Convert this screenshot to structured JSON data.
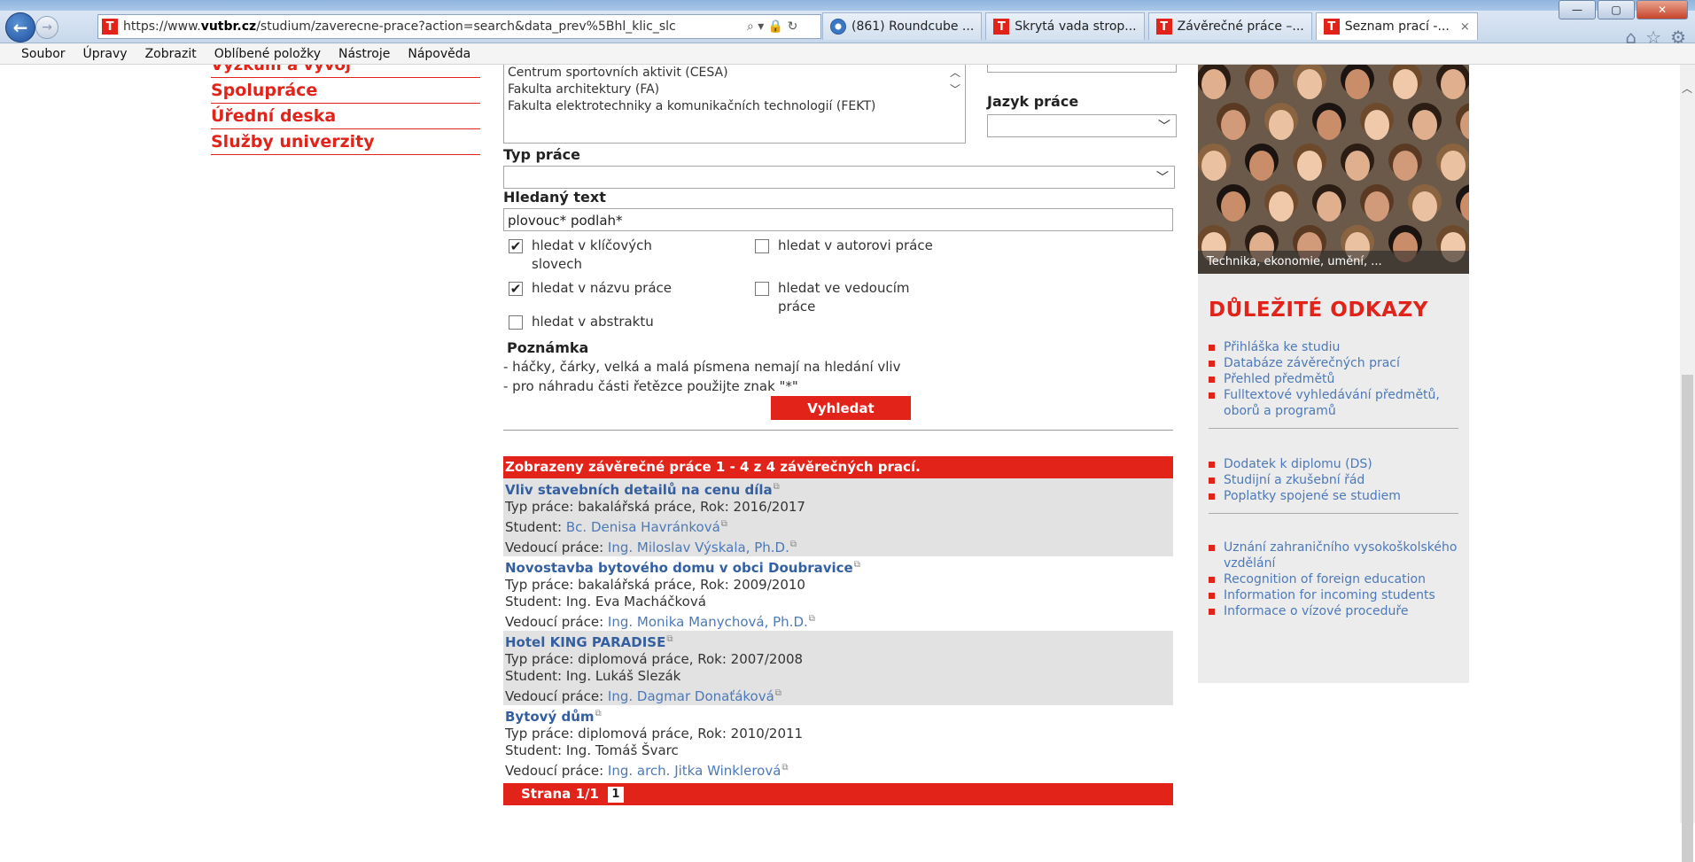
{
  "browser": {
    "address": {
      "scheme": "https://www.",
      "domain": "vutbr.cz",
      "path": "/studium/zaverecne-prace?action=search&data_prev%5Bhl_klic_slc",
      "icons": "⌕ ▾ 🔒 ↻"
    },
    "tabs": [
      {
        "label": "(861) Roundcube ...",
        "icon": "roundcube-icon"
      },
      {
        "label": "Skrytá vada strop...",
        "icon": "vut-favicon"
      },
      {
        "label": "Závěrečné práce –...",
        "icon": "vut-favicon"
      },
      {
        "label": "Seznam prací -...",
        "icon": "vut-favicon",
        "active": true
      }
    ],
    "favicon_letter": "T",
    "tab_close": "×",
    "window_controls": {
      "minimize": "—",
      "maximize": "▢",
      "close": "✕"
    },
    "toolbar_icons": {
      "home": "⌂",
      "favorites": "☆",
      "settings": "⚙"
    },
    "menu": [
      "Soubor",
      "Úpravy",
      "Zobrazit",
      "Oblíbené položky",
      "Nástroje",
      "Nápověda"
    ]
  },
  "left_nav": {
    "partial": "Výzkum a vývoj",
    "items": [
      "Spolupráce",
      "Úřední deska",
      "Služby univerzity"
    ]
  },
  "form": {
    "faculties": [
      "Centrum sportovních aktivit (CESA)",
      "Fakulta architektury (FA)",
      "Fakulta elektrotechniky a komunikačních technologií (FEKT)"
    ],
    "language_label": "Jazyk práce",
    "language_value": "",
    "type_label": "Typ práce",
    "type_value": "",
    "text_label": "Hledaný text",
    "text_value": "plovouc* podlah*",
    "checkboxes": [
      {
        "label": "hledat v klíčových slovech",
        "checked": true
      },
      {
        "label": "hledat v autorovi práce",
        "checked": false
      },
      {
        "label": "hledat v názvu práce",
        "checked": true
      },
      {
        "label": "hledat ve vedoucím práce",
        "checked": false
      },
      {
        "label": "hledat v abstraktu",
        "checked": false
      }
    ],
    "check_mark": "✔",
    "note_title": "Poznámka",
    "note_lines": [
      "- háčky, čárky, velká a malá písmena nemají na hledání vliv",
      "- pro náhradu části řetězce použijte znak \"*\""
    ],
    "search_button": "Vyhledat",
    "chevron": "﹀"
  },
  "results": {
    "header": "Zobrazeny závěrečné práce 1 - 4 z 4 závěrečných prací.",
    "items": [
      {
        "title": "Vliv stavebních detailů na cenu díla",
        "type_line": "Typ práce: bakalářská práce, Rok: 2016/2017",
        "student_label": "Student: ",
        "student": "Bc. Denisa Havránková",
        "supervisor_label": "Vedoucí práce: ",
        "supervisor": "Ing. Miloslav Výskala, Ph.D."
      },
      {
        "title": "Novostavba bytového domu v obci Doubravice",
        "type_line": "Typ práce: bakalářská práce, Rok: 2009/2010",
        "student_label": "Student: ",
        "student": "Ing. Eva Macháčková",
        "supervisor_label": "Vedoucí práce: ",
        "supervisor": "Ing. Monika Manychová, Ph.D."
      },
      {
        "title": "Hotel KING PARADISE",
        "type_line": "Typ práce: diplomová práce, Rok: 2007/2008",
        "student_label": "Student: ",
        "student": "Ing. Lukáš Slezák",
        "supervisor_label": "Vedoucí práce: ",
        "supervisor": "Ing. Dagmar Donaťáková"
      },
      {
        "title": "Bytový dům",
        "type_line": "Typ práce: diplomová práce, Rok: 2010/2011",
        "student_label": "Student: ",
        "student": "Ing. Tomáš Švarc",
        "supervisor_label": "Vedoucí práce: ",
        "supervisor": "Ing. arch. Jitka Winklerová"
      }
    ],
    "ext_marker": "⧉",
    "pager_label": "Strana 1/1",
    "pager_page": "1"
  },
  "sidebar": {
    "photo_caption": "Technika, ekonomie, umění, ...",
    "links_title": "DŮLEŽITÉ ODKAZY",
    "groups": [
      [
        "Přihláška ke studiu",
        "Databáze závěrečných prací",
        "Přehled předmětů",
        "Fulltextové vyhledávání předmětů, oborů a programů"
      ],
      [
        "Dodatek k diplomu (DS)",
        "Studijní a zkušební řád",
        "Poplatky spojené se studiem"
      ],
      [
        "Uznání zahraničního vysokoškolského vzdělání",
        "Recognition of foreign education",
        "Information for incoming students",
        "Informace o vízové proceduře"
      ]
    ]
  },
  "colors": {
    "brand_red": "#e2231a",
    "link_blue": "#4d79b8",
    "title_blue": "#345fa0"
  }
}
